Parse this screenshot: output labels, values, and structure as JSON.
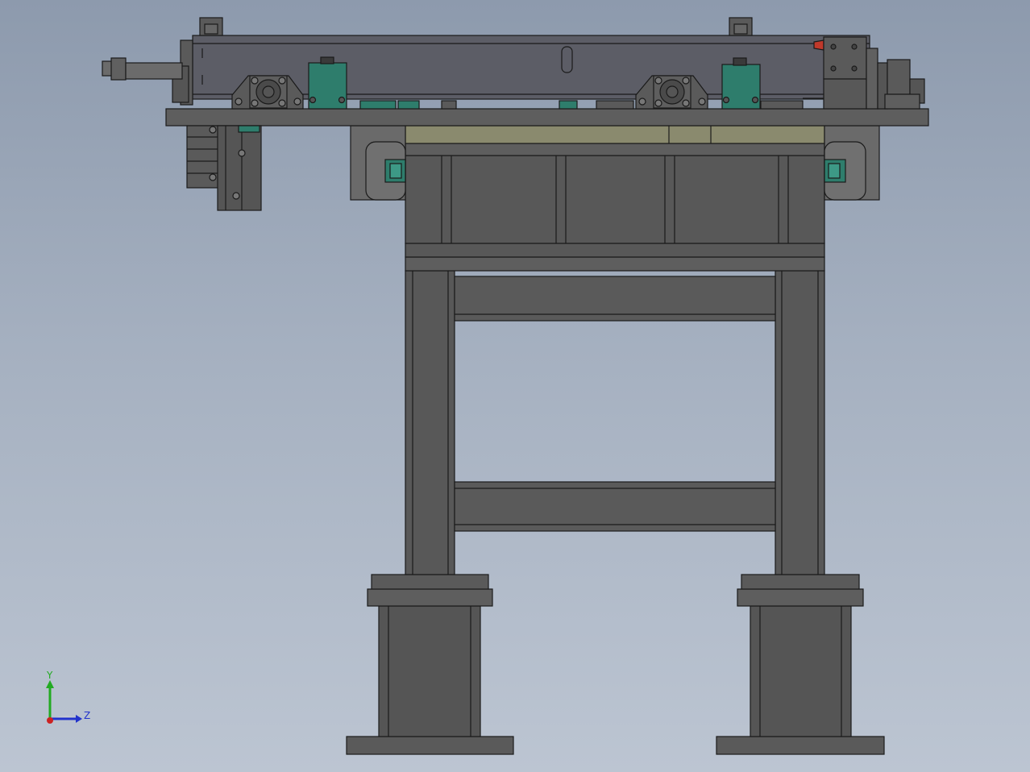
{
  "viewport": {
    "background_top": "#8d9aad",
    "background_bottom": "#bcc5d2"
  },
  "colors": {
    "body": "#5a5a5a",
    "body_dark": "#4a4a4a",
    "plate": "#5e5e5e",
    "beam": "#5c5d66",
    "olive": "#8a8a6e",
    "teal": "#2e7d6c",
    "teal_light": "#3d9986",
    "red": "#c0392b",
    "steel": "#6b6b6b",
    "outline": "#1a1a1a"
  },
  "triad": {
    "y_label": "Y",
    "z_label": "Z",
    "y_color": "#22aa22",
    "z_color": "#2233cc",
    "x_color": "#cc2222",
    "icon": "coordinate-triad-icon"
  }
}
